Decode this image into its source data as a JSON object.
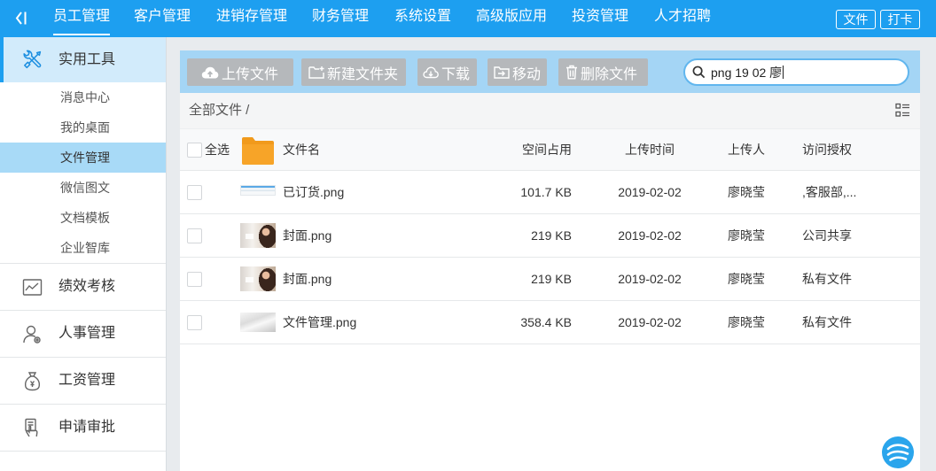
{
  "nav": {
    "collapse_icon": "collapse-sidebar-icon",
    "items": [
      {
        "label": "员工管理",
        "active": true
      },
      {
        "label": "客户管理"
      },
      {
        "label": "进销存管理"
      },
      {
        "label": "财务管理"
      },
      {
        "label": "系统设置"
      },
      {
        "label": "高级版应用"
      },
      {
        "label": "投资管理"
      },
      {
        "label": "人才招聘"
      }
    ],
    "right_buttons": [
      {
        "label": "文件"
      },
      {
        "label": "打卡"
      }
    ]
  },
  "sidebar": {
    "sections": [
      {
        "label": "实用工具",
        "icon": "tools-icon",
        "expanded": true,
        "items": [
          {
            "label": "消息中心"
          },
          {
            "label": "我的桌面"
          },
          {
            "label": "文件管理",
            "active": true
          },
          {
            "label": "微信图文"
          },
          {
            "label": "文档模板"
          },
          {
            "label": "企业智库"
          }
        ]
      },
      {
        "label": "绩效考核",
        "icon": "performance-chart-icon"
      },
      {
        "label": "人事管理",
        "icon": "person-settings-icon"
      },
      {
        "label": "工资管理",
        "icon": "money-bag-icon"
      },
      {
        "label": "申请审批",
        "icon": "approval-hand-icon"
      }
    ]
  },
  "toolbar": {
    "buttons": [
      {
        "label": "上传文件",
        "icon": "cloud-upload-icon"
      },
      {
        "label": "新建文件夹",
        "icon": "new-folder-icon"
      },
      {
        "label": "下载",
        "icon": "download-icon"
      },
      {
        "label": "移动",
        "icon": "move-icon"
      },
      {
        "label": "删除文件",
        "icon": "trash-icon"
      }
    ],
    "search": {
      "value": "png 19 02 廖",
      "icon": "search-icon"
    }
  },
  "breadcrumb": {
    "path": "全部文件 /",
    "view_toggle_icon": "list-view-icon"
  },
  "table": {
    "select_all_label": "全选",
    "header_icon": "folder-icon",
    "columns": {
      "name": "文件名",
      "size": "空间占用",
      "upload_time": "上传时间",
      "uploader": "上传人",
      "access": "访问授权"
    },
    "rows": [
      {
        "name": "已订货.png",
        "size": "101.7 KB",
        "upload_time": "2019-02-02",
        "uploader": "廖晓莹",
        "access": ",客服部,..."
      },
      {
        "name": "封面.png",
        "size": "219 KB",
        "upload_time": "2019-02-02",
        "uploader": "廖晓莹",
        "access": "公司共享"
      },
      {
        "name": "封面.png",
        "size": "219 KB",
        "upload_time": "2019-02-02",
        "uploader": "廖晓莹",
        "access": "私有文件"
      },
      {
        "name": "文件管理.png",
        "size": "358.4 KB",
        "upload_time": "2019-02-02",
        "uploader": "廖晓莹",
        "access": "私有文件"
      }
    ]
  },
  "floating_icon": "brand-logo-icon",
  "colors": {
    "nav_bg": "#1d9ff0",
    "toolbar_bg": "#a4d5f5",
    "active_item_bg": "#a8daf7",
    "section_active_bg": "#d2ebfb",
    "button_bg": "#b5b8bb",
    "folder": "#f7a428",
    "page_bg": "#e8ebee"
  }
}
